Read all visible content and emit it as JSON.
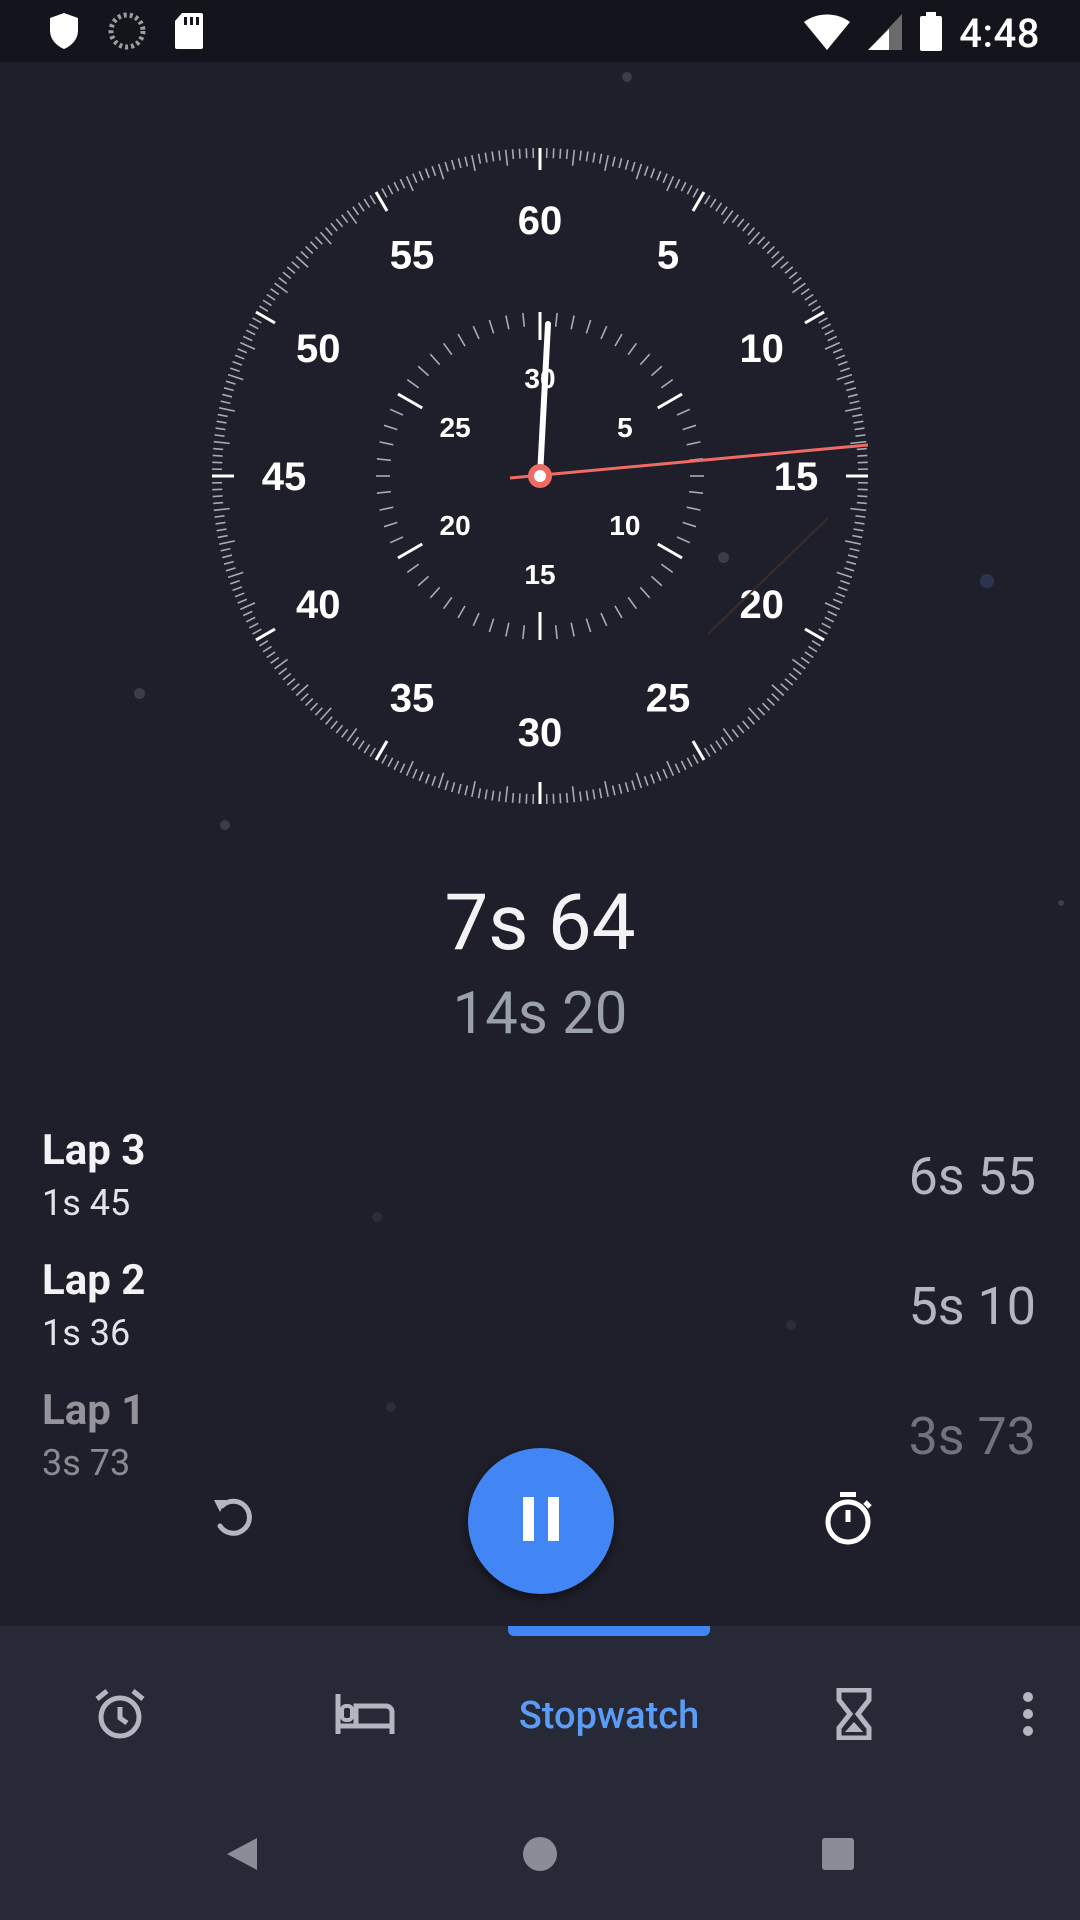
{
  "status_bar": {
    "time": "4:48"
  },
  "stopwatch": {
    "outer_labels": [
      "60",
      "5",
      "10",
      "15",
      "20",
      "25",
      "30",
      "35",
      "40",
      "45",
      "50",
      "55"
    ],
    "inner_labels": [
      "30",
      "5",
      "10",
      "15",
      "20",
      "25"
    ],
    "main_time": "7s 64",
    "current_lap_time": "14s 20",
    "hand_color": "#ffffff",
    "lap_hand_color": "#f06b63"
  },
  "laps": [
    {
      "name": "Lap 3",
      "split": "1s 45",
      "total": "6s 55"
    },
    {
      "name": "Lap 2",
      "split": "1s 36",
      "total": "5s 10"
    },
    {
      "name": "Lap 1",
      "split": "3s 73",
      "total": "3s 73"
    }
  ],
  "controls": {
    "reset_icon": "reset-icon",
    "pause_icon": "pause-icon",
    "lap_icon": "stopwatch-icon"
  },
  "tabs": {
    "active_label": "Stopwatch",
    "accent": "#4285f4"
  }
}
